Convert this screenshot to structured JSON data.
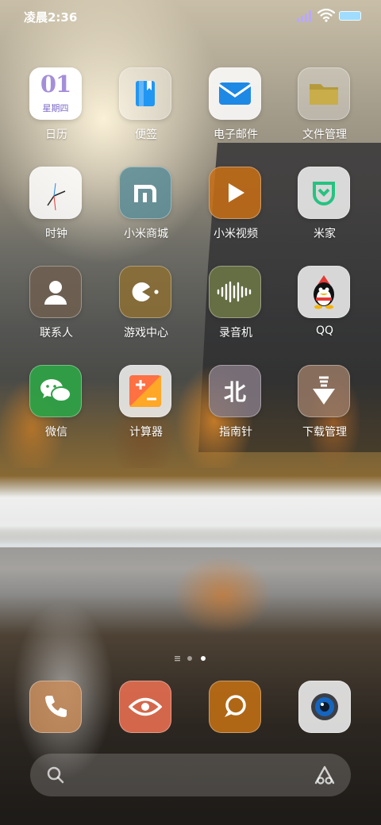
{
  "status_bar": {
    "time": "凌晨2:36"
  },
  "apps": [
    {
      "label": "日历",
      "icon": "calendar-icon",
      "cal_number": "01",
      "cal_weekday": "星期四"
    },
    {
      "label": "便签",
      "icon": "notes-icon"
    },
    {
      "label": "电子邮件",
      "icon": "mail-icon"
    },
    {
      "label": "文件管理",
      "icon": "folder-icon"
    },
    {
      "label": "时钟",
      "icon": "clock-icon"
    },
    {
      "label": "小米商城",
      "icon": "mi-store-icon"
    },
    {
      "label": "小米视频",
      "icon": "video-play-icon"
    },
    {
      "label": "米家",
      "icon": "mijia-icon"
    },
    {
      "label": "联系人",
      "icon": "contacts-icon"
    },
    {
      "label": "游戏中心",
      "icon": "game-center-icon"
    },
    {
      "label": "录音机",
      "icon": "recorder-icon"
    },
    {
      "label": "QQ",
      "icon": "qq-penguin-icon"
    },
    {
      "label": "微信",
      "icon": "wechat-icon"
    },
    {
      "label": "计算器",
      "icon": "calculator-icon"
    },
    {
      "label": "指南针",
      "icon": "compass-icon",
      "glyph": "北"
    },
    {
      "label": "下载管理",
      "icon": "download-icon"
    }
  ],
  "page_indicator": {
    "pages": 3,
    "current": 3
  },
  "dock": [
    {
      "icon": "phone-icon"
    },
    {
      "icon": "browser-eye-icon"
    },
    {
      "icon": "messages-icon"
    },
    {
      "icon": "camera-icon"
    }
  ],
  "search_bar": {
    "left_icon": "search-icon",
    "right_icon": "assistant-icon"
  },
  "colors": {
    "calendar_accent": "#a58ed9",
    "signal": "#b9a8ff",
    "battery": "#9fdcff"
  }
}
